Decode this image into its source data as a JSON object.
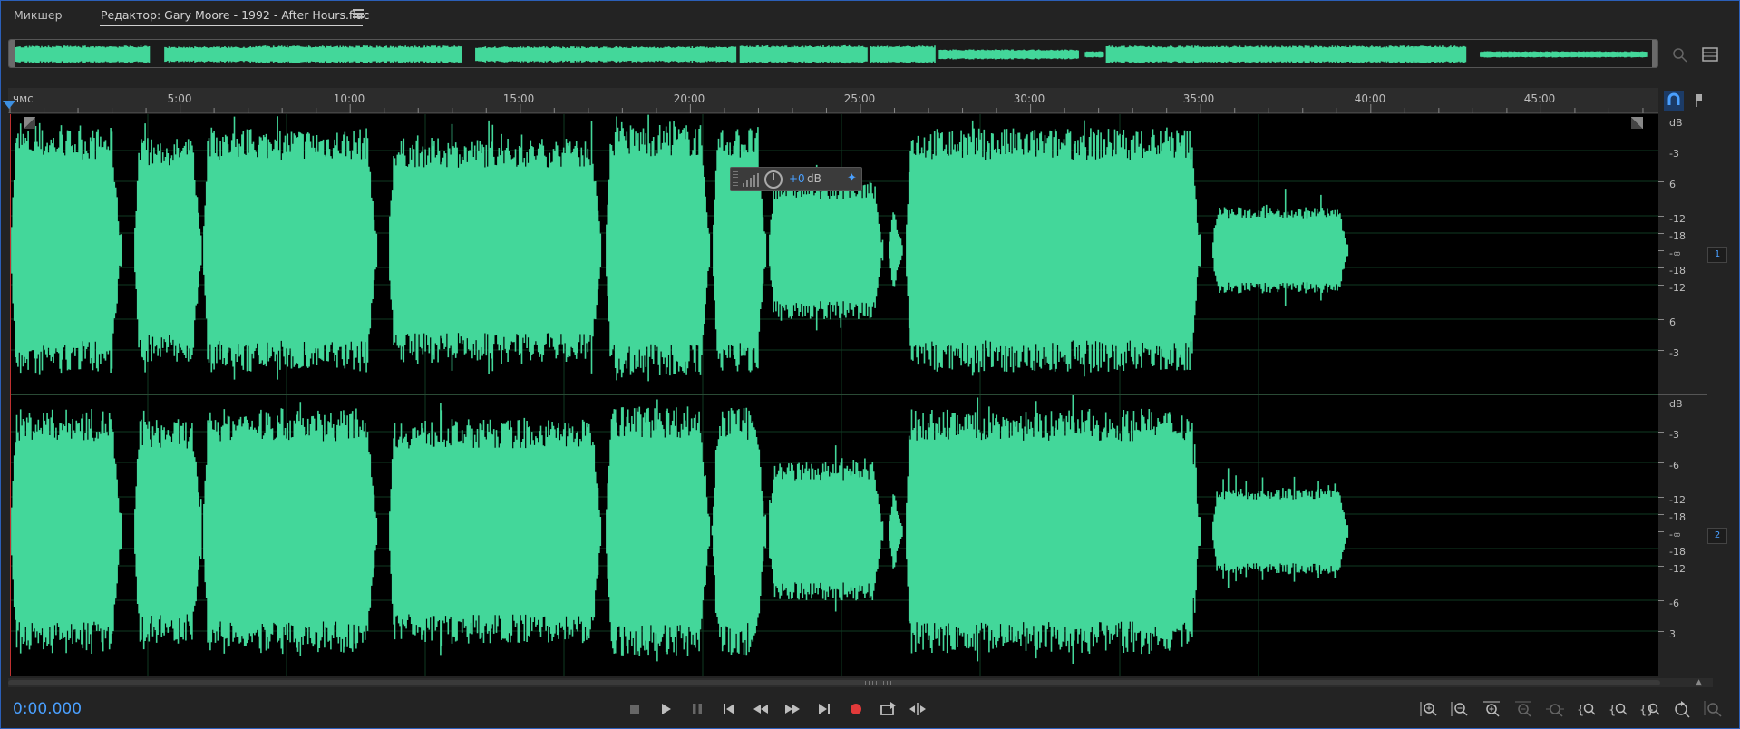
{
  "tabs": {
    "mixer": "Микшер",
    "editor": "Редактор: Gary Moore - 1992 - After Hours.flac"
  },
  "ruler": {
    "unit_label": "чмс",
    "labels": [
      "5:00",
      "10:00",
      "15:00",
      "20:00",
      "25:00",
      "30:00",
      "35:00",
      "40:00",
      "45:00"
    ]
  },
  "hud": {
    "value": "+0",
    "unit": "dB"
  },
  "db_scale": {
    "channel1": [
      "dB",
      "-3",
      "6",
      "-12",
      "-18",
      "-∞",
      "-18",
      "-12",
      "6",
      "-3"
    ],
    "channel2": [
      "dB",
      "-3",
      "-6",
      "-12",
      "-18",
      "-∞",
      "-18",
      "-12",
      "-6",
      "3"
    ]
  },
  "channels": [
    "1",
    "2"
  ],
  "time_display": "0:00.000",
  "colors": {
    "waveform": "#43d79a",
    "accent": "#4aa0ff",
    "record": "#e23a3a"
  },
  "transport_icons": [
    "stop-icon",
    "play-icon",
    "pause-icon",
    "skip-to-start-icon",
    "rewind-icon",
    "fast-forward-icon",
    "skip-to-end-icon",
    "record-icon",
    "loop-icon",
    "skip-selection-icon"
  ],
  "zoom_icons": [
    "zoom-in-amplitude-icon",
    "zoom-out-amplitude-icon",
    "zoom-in-time-icon",
    "zoom-out-time-icon",
    "zoom-full-icon",
    "zoom-selection-icon",
    "zoom-in-point-icon",
    "zoom-out-point-icon",
    "zoom-both-icon",
    "zoom-reset-icon",
    "zoom-extra-icon"
  ]
}
